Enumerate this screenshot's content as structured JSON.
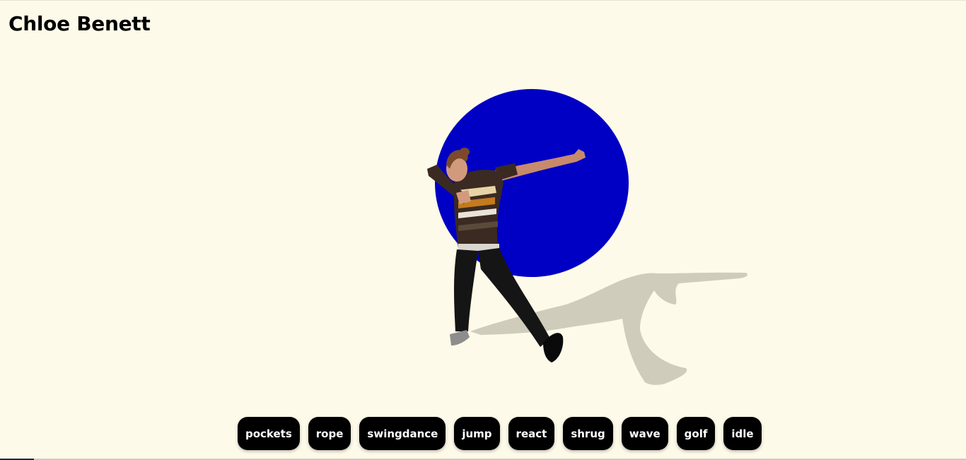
{
  "header": {
    "title": "Chloe Benett"
  },
  "scene": {
    "backdrop_color": "#0000c4",
    "shadow_color": "#cbc7b6",
    "character": "avatar-figure"
  },
  "controls": {
    "buttons": [
      {
        "label": "pockets"
      },
      {
        "label": "rope"
      },
      {
        "label": "swingdance"
      },
      {
        "label": "jump"
      },
      {
        "label": "react"
      },
      {
        "label": "shrug"
      },
      {
        "label": "wave"
      },
      {
        "label": "golf"
      },
      {
        "label": "idle"
      }
    ]
  }
}
